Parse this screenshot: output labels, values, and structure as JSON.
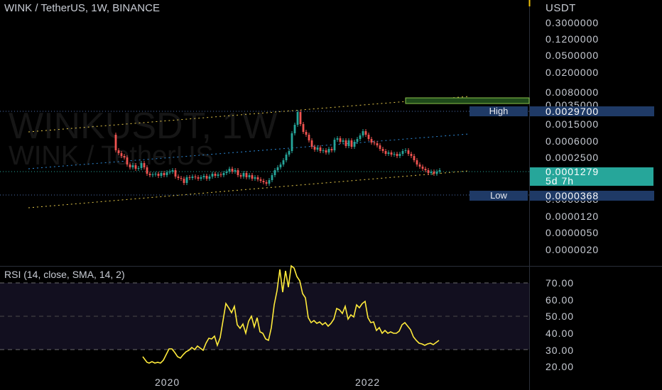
{
  "header": {
    "title": "WINK / TetherUS, 1W, BINANCE"
  },
  "watermark": {
    "line1": "WINKUSDT, 1W",
    "line2": "WINK / TetherUS"
  },
  "price_axis": {
    "unit": "USDT",
    "labels": [
      "0.3000000",
      "0.1200000",
      "0.0500000",
      "0.0200000",
      "0.0080000",
      "0.0035000",
      "0.0015000",
      "0.0006000",
      "0.0002500",
      "0.0000368",
      "0.0000120",
      "0.0000050",
      "0.0000020"
    ]
  },
  "high_tag": {
    "label": "High",
    "value": "0.0029700"
  },
  "low_tag": {
    "label": "Low",
    "value": "0.0000368"
  },
  "last_price": {
    "value": "0.0001279",
    "countdown": "5d 7h"
  },
  "rsi": {
    "title": "RSI (14, close, SMA, 14, 2)",
    "labels": [
      "70.00",
      "60.00",
      "50.00",
      "40.00",
      "30.00",
      "20.00"
    ]
  },
  "time_axis": {
    "labels": [
      "2020",
      "2022"
    ]
  },
  "colors": {
    "up": "#26a69a",
    "down": "#ef5350",
    "rsi_line": "#ffeb3b",
    "tag_bg": "#1f3a66",
    "price_tag": "#26a69a",
    "rsi_band": "#120f1f"
  }
}
